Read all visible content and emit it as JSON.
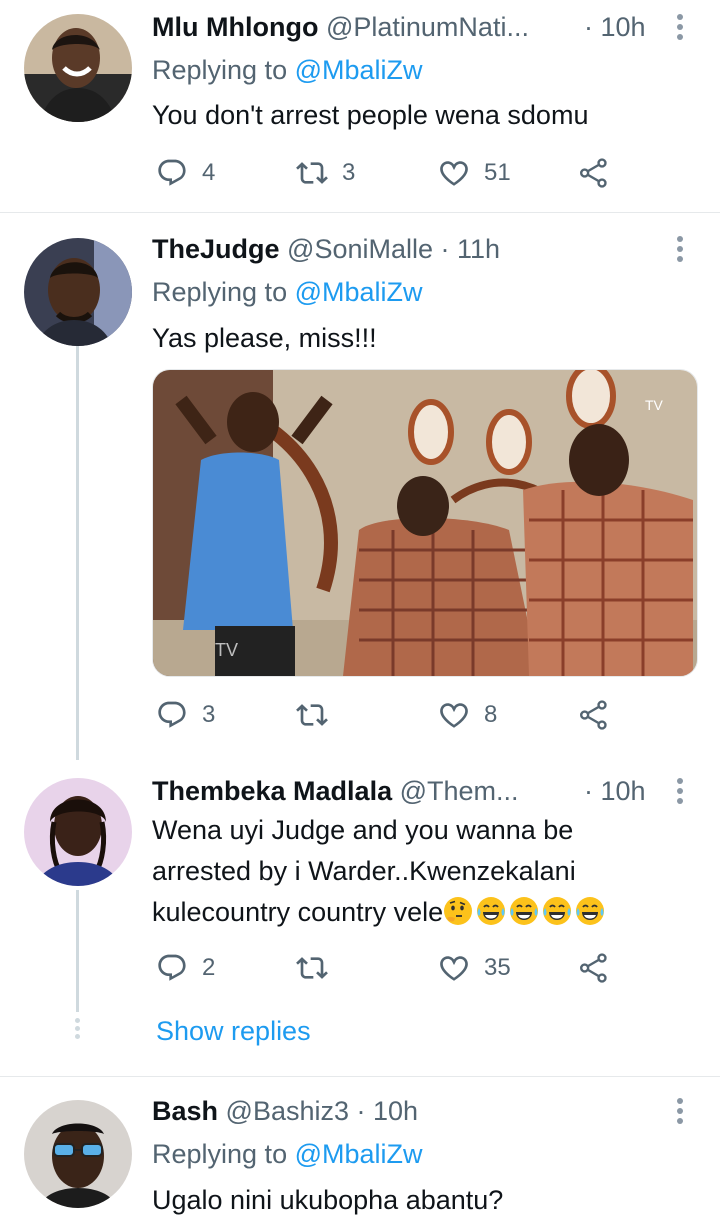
{
  "tweets": [
    {
      "name": "Mlu Mhlongo",
      "handle": "@PlatinumNati...",
      "time": "· 10h",
      "replying_label": "Replying to",
      "replying_to": "@MbaliZw",
      "text": "You don't arrest people wena sdomu",
      "replies": "4",
      "retweets": "3",
      "likes": "51"
    },
    {
      "name": "TheJudge",
      "handle": "@SoniMalle",
      "time": "· 11h",
      "replying_label": "Replying to",
      "replying_to": "@MbaliZw",
      "text": "Yas please, miss!!!",
      "media_watermark": "TV",
      "replies": "3",
      "retweets": "",
      "likes": "8"
    },
    {
      "name": "Thembeka Madlala",
      "handle": "@Them...",
      "time": "· 10h",
      "text_lines": [
        "Wena uyi Judge and you wanna be",
        "arrested by i Warder..Kwenzekalani",
        "kulecountry country vele"
      ],
      "emojis": [
        "thinking-face",
        "tears-of-joy",
        "tears-of-joy",
        "tears-of-joy",
        "tears-of-joy"
      ],
      "replies": "2",
      "retweets": "",
      "likes": "35",
      "show_replies": "Show replies"
    },
    {
      "name": "Bash",
      "handle": "@Bashiz3",
      "time": "· 10h",
      "replying_label": "Replying to",
      "replying_to": "@MbaliZw",
      "text": "Ugalo nini ukubopha abantu?"
    }
  ],
  "colors": {
    "text": "#0f1419",
    "secondary": "#536471",
    "link": "#1d9bf0",
    "divider": "#e6e9eb",
    "thread": "#cfd9de"
  },
  "icons": [
    "reply-icon",
    "retweet-icon",
    "like-icon",
    "share-icon",
    "more-icon"
  ]
}
